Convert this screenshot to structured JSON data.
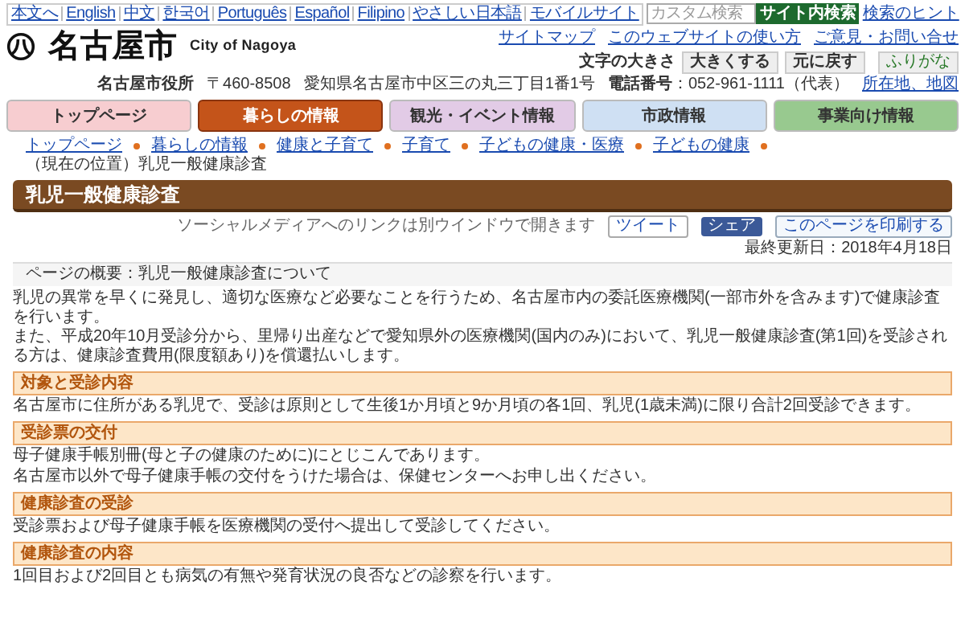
{
  "utility_bar": {
    "links": [
      "本文へ",
      "English",
      "中文",
      "한국어",
      "Português",
      "Español",
      "Filipino",
      "やさしい日本語",
      "モバイルサイト"
    ],
    "search": {
      "placeholder": "カスタム検索"
    },
    "search_button": "サイト内検索",
    "hint_link": "検索のヒント"
  },
  "header": {
    "logo": "名古屋市",
    "logo_en": "City of Nagoya",
    "links": [
      "サイトマップ",
      "このウェブサイトの使い方",
      "ご意見・お問い合せ"
    ],
    "text_size_label": "文字の大きさ",
    "text_size_buttons": [
      "大きくする",
      "元に戻す"
    ],
    "furigana": "ふりがな",
    "office": "名古屋市役所",
    "postal": "〒460-8508",
    "address": "愛知県名古屋市中区三の丸三丁目1番1号",
    "phone_label": "電話番号",
    "phone": "：052-961-1111（代表）",
    "map_link": "所在地、地図"
  },
  "nav_tabs": [
    {
      "label": "トップページ",
      "selected": false,
      "color": "#f7cdd0"
    },
    {
      "label": "暮らしの情報",
      "selected": true,
      "color": "#c4541a"
    },
    {
      "label": "観光・イベント情報",
      "selected": false,
      "color": "#e2cbe6"
    },
    {
      "label": "市政情報",
      "selected": false,
      "color": "#cfe0f3"
    },
    {
      "label": "事業向け情報",
      "selected": false,
      "color": "#98c98f"
    }
  ],
  "breadcrumb": {
    "items": [
      "トップページ",
      "暮らしの情報",
      "健康と子育て",
      "子育て",
      "子どもの健康・医療",
      "子どもの健康"
    ],
    "current": "（現在の位置）乳児一般健康診査"
  },
  "page_title": "乳児一般健康診査",
  "social": {
    "note": "ソーシャルメディアへのリンクは別ウインドウで開きます",
    "tweet": "ツイート",
    "share": "シェア",
    "print": "このページを印刷する",
    "updated": "最終更新日：2018年4月18日"
  },
  "summary": "ページの概要：乳児一般健康診査について",
  "intro": [
    "乳児の異常を早くに発見し、適切な医療など必要なことを行うため、名古屋市内の委託医療機関(一部市外を含みます)で健康診査を行います。",
    "また、平成20年10月受診分から、里帰り出産などで愛知県外の医療機関(国内のみ)において、乳児一般健康診査(第1回)を受診される方は、健康診査費用(限度額あり)を償還払いします。"
  ],
  "sections": [
    {
      "heading": "対象と受診内容",
      "paragraphs": [
        "名古屋市に住所がある乳児で、受診は原則として生後1か月頃と9か月頃の各1回、乳児(1歳未満)に限り合計2回受診できます。"
      ]
    },
    {
      "heading": "受診票の交付",
      "paragraphs": [
        "母子健康手帳別冊(母と子の健康のために)にとじこんであります。",
        "名古屋市以外で母子健康手帳の交付をうけた場合は、保健センターへお申し出ください。"
      ]
    },
    {
      "heading": "健康診査の受診",
      "paragraphs": [
        "受診票および母子健康手帳を医療機関の受付へ提出して受診してください。"
      ]
    },
    {
      "heading": "健康診査の内容",
      "paragraphs": [
        "1回目および2回目とも病気の有無や発育状況の良否などの診察を行います。"
      ]
    }
  ]
}
